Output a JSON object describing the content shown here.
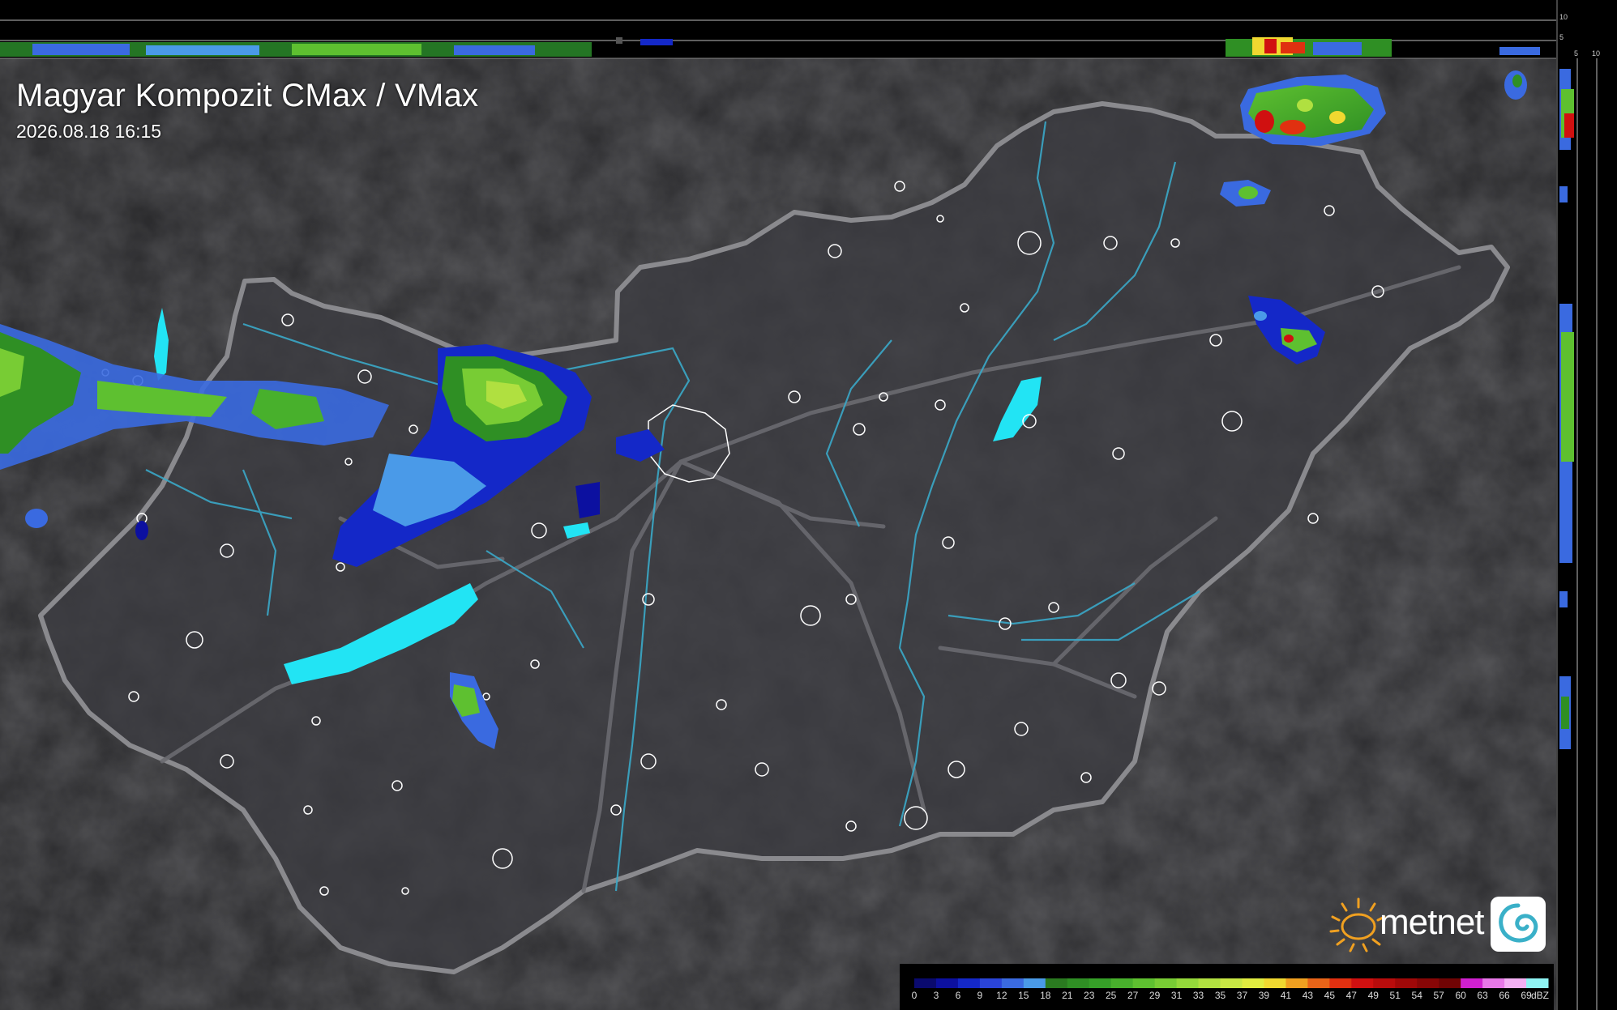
{
  "title": "Magyar Kompozit CMax / VMax",
  "timestamp": "2026.08.18 16:15",
  "brand": "metnet",
  "legend": {
    "unit": "dBZ",
    "ticks": [
      "0",
      "3",
      "6",
      "9",
      "12",
      "15",
      "18",
      "21",
      "23",
      "25",
      "27",
      "29",
      "31",
      "33",
      "35",
      "37",
      "39",
      "41",
      "43",
      "45",
      "47",
      "49",
      "51",
      "54",
      "57",
      "60",
      "63",
      "66",
      "69"
    ],
    "colors": [
      "#0a0a6e",
      "#0c10a0",
      "#1428c8",
      "#2a44d8",
      "#3a6ae0",
      "#4a9ae8",
      "#2a7a20",
      "#2f8f24",
      "#36a028",
      "#48b02c",
      "#5ec030",
      "#78cc34",
      "#94d83a",
      "#b0e040",
      "#c8e844",
      "#e0ec40",
      "#f0d830",
      "#f0a020",
      "#e86418",
      "#e03010",
      "#d01010",
      "#b80c0c",
      "#a00808",
      "#880606",
      "#700404",
      "#d020d0",
      "#e878e8",
      "#f4b0f4",
      "#8ff4f4"
    ]
  },
  "side_profile_ticks": {
    "top": [
      "10",
      "5"
    ],
    "right": [
      "5",
      "10"
    ]
  },
  "colors": {
    "background": "#2e2e32",
    "border": "#8a8a8e",
    "river": "#3aa8c8",
    "lake": "#22e4f4"
  }
}
